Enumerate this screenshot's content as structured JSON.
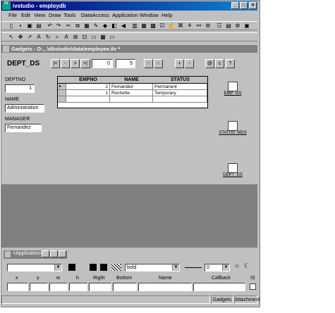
{
  "app": {
    "title": "ivstudio - employdb",
    "icon_text": "IV"
  },
  "title_buttons": {
    "minimize": "_",
    "maximize": "□",
    "close": "×"
  },
  "menu": [
    "File",
    "Edit",
    "View",
    "Draw",
    "Tools",
    "DataAccess",
    "Application",
    "Window",
    "Help"
  ],
  "gadgets_window": {
    "title": "Gadgets - D:...\\dbstudio\\data\\employee.ilv *"
  },
  "navigator": {
    "name": "DEPT_DS",
    "buttons": [
      "|<",
      "<",
      ">",
      ">|"
    ],
    "record": "0",
    "count": "5",
    "action_buttons": [
      "V",
      "x",
      "+",
      "-",
      "@",
      "c",
      "?"
    ]
  },
  "form": {
    "deptno_label": "DEPTNO",
    "deptno_value": "1",
    "name_label": "NAME",
    "name_value": "Administration",
    "manager_label": "MANAGER",
    "manager_value": "Fernandez"
  },
  "table": {
    "columns": [
      "EMPNO",
      "NAME",
      "STATUS"
    ],
    "rows": [
      {
        "marker": "▸",
        "empno": "2",
        "name": "Fernandez",
        "status": "Permanent"
      },
      {
        "marker": "",
        "empno": "1",
        "name": "Rochette",
        "status": "Temporary"
      },
      {
        "marker": "",
        "empno": "",
        "name": "",
        "status": ""
      }
    ]
  },
  "datasources": [
    "EMP_DS",
    "STATUS_MDS",
    "DEPT_DS"
  ],
  "application_window": {
    "title": "<Application>"
  },
  "inspector": {
    "font_weight": "bold",
    "line_width": "0",
    "columns": [
      "x",
      "y",
      "w",
      "h",
      "Right",
      "Bottom",
      "Name",
      "Callback",
      "IS"
    ]
  },
  "statusbar": [
    "Gadgets",
    "Attachment"
  ]
}
